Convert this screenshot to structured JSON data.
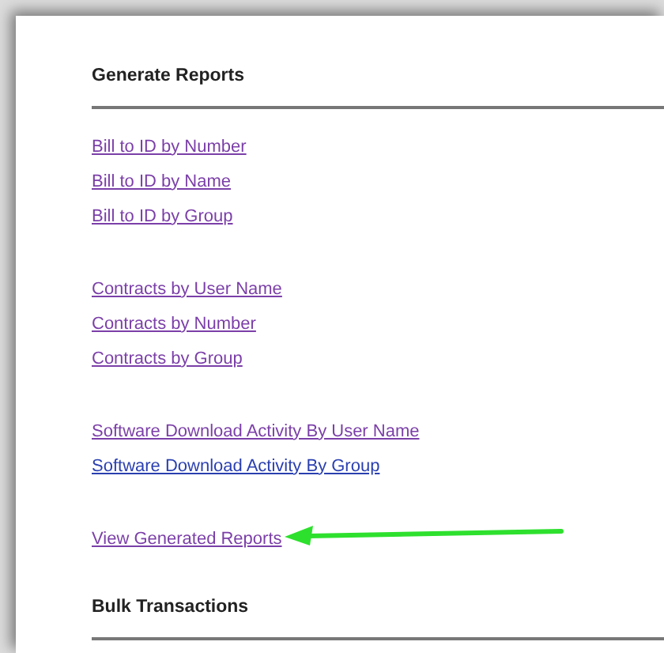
{
  "sections": [
    {
      "title": "Generate Reports",
      "groups": [
        [
          {
            "label": "Bill to ID by Number",
            "visited": true,
            "arrow": false
          },
          {
            "label": "Bill to ID by Name",
            "visited": true,
            "arrow": false
          },
          {
            "label": "Bill to ID by Group",
            "visited": true,
            "arrow": false
          }
        ],
        [
          {
            "label": "Contracts by User Name",
            "visited": true,
            "arrow": false
          },
          {
            "label": "Contracts by Number",
            "visited": true,
            "arrow": false
          },
          {
            "label": "Contracts by Group",
            "visited": true,
            "arrow": false
          }
        ],
        [
          {
            "label": "Software Download Activity By User Name",
            "visited": true,
            "arrow": false
          },
          {
            "label": "Software Download Activity By Group",
            "visited": false,
            "arrow": false
          }
        ],
        [
          {
            "label": "View Generated Reports",
            "visited": true,
            "arrow": true
          }
        ]
      ]
    },
    {
      "title": "Bulk Transactions"
    }
  ]
}
